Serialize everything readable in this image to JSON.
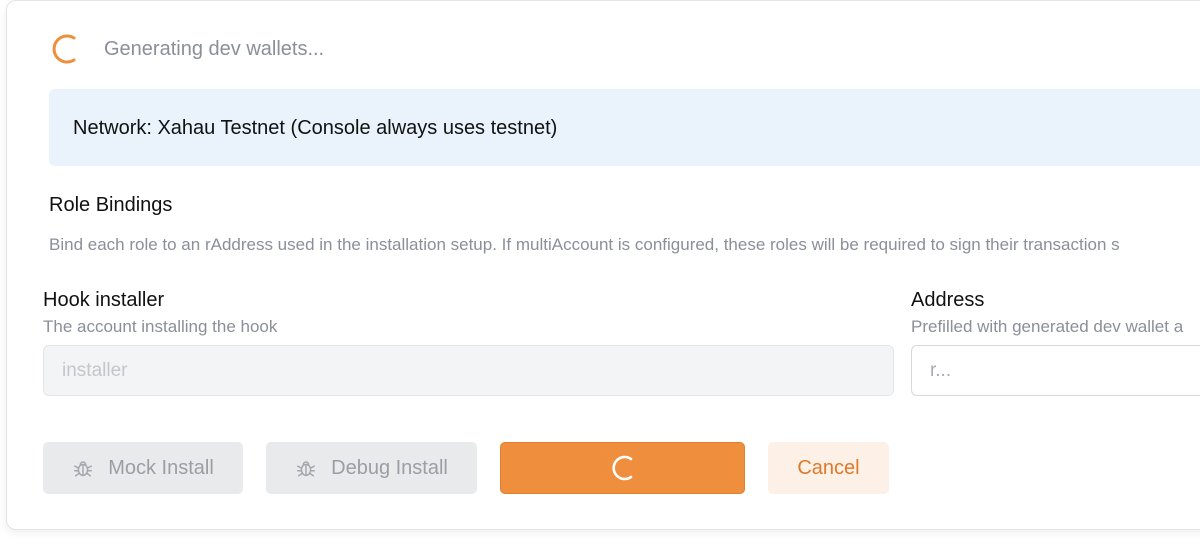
{
  "status": {
    "text": "Generating dev wallets..."
  },
  "banner": {
    "text": "Network: Xahau Testnet (Console always uses testnet)"
  },
  "role_bindings": {
    "title": "Role Bindings",
    "description": "Bind each role to an rAddress used in the installation setup. If multiAccount is configured, these roles will be required to sign their transaction s"
  },
  "hook_installer": {
    "label": "Hook installer",
    "hint": "The account installing the hook",
    "placeholder": "installer"
  },
  "address": {
    "label": "Address",
    "hint": "Prefilled with generated dev wallet a",
    "placeholder": "r..."
  },
  "buttons": {
    "mock_install": "Mock Install",
    "debug_install": "Debug Install",
    "cancel": "Cancel"
  },
  "icons": {
    "status": "spinner-icon",
    "mock": "bug-icon",
    "debug": "bug-icon",
    "primary": "spinner-icon"
  },
  "colors": {
    "accent": "#ef8f3d",
    "accent_text": "#e0782a",
    "banner_bg": "#eaf2fc",
    "muted_text": "#8a8f98"
  }
}
